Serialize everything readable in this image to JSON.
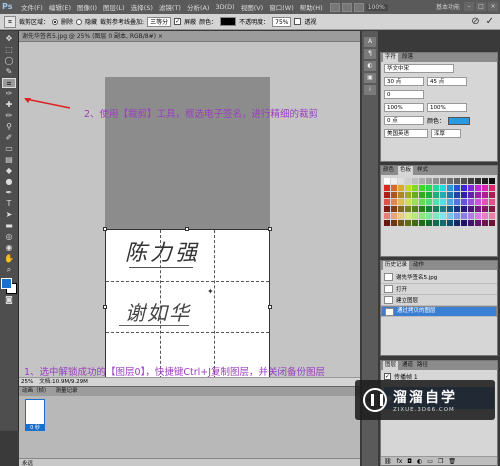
{
  "menubar": {
    "logo": "Ps",
    "items": [
      "文件(F)",
      "编辑(E)",
      "图像(I)",
      "图层(L)",
      "选择(S)",
      "滤镜(T)",
      "分析(A)",
      "3D(D)",
      "视图(V)",
      "窗口(W)",
      "帮助(H)"
    ],
    "zoom": "100%",
    "workspace": "基本功能",
    "win_min": "–",
    "win_max": "□",
    "win_close": "×"
  },
  "options": {
    "tool_icon": "crop-icon",
    "crop_area_label": "裁剪区域：",
    "delete_label": "删除",
    "hide_label": "隐藏",
    "guide_label": "裁剪参考线叠加:",
    "guide_value": "三等分",
    "shield_label": "屏蔽",
    "color_label": "颜色：",
    "opacity_label": "不透明度：",
    "opacity_value": "75%",
    "perspective_label": "透视",
    "cancel_glyph": "⊘",
    "commit_glyph": "✓"
  },
  "document": {
    "tab_title": "谢先华签名5.jpg @ 25% (图层 0 副本, RGB/8#) ×",
    "signature_top": "陈力强",
    "signature_bottom": "谢如华",
    "zoom_status": "25%",
    "doc_status": "文档:10.9M/9.29M"
  },
  "annotations": {
    "step2": "2、使用【裁剪】工具，框选电子签名，进行精细的裁剪",
    "step1": "1、选中解锁成功的【图层0】，快捷键Ctrl+J复制图层，并关闭备份图层"
  },
  "animation": {
    "tab1": "动画（帧）",
    "tab2": "测量记录",
    "frame_label": "0 秒",
    "footer": "永远"
  },
  "char_panel": {
    "tab1": "字符",
    "tab2": "段落",
    "font": "华文中宋",
    "size": "30 点",
    "leading": "45 点",
    "tracking": "0",
    "scale_v": "100%",
    "scale_h": "100%",
    "baseline": "0 点",
    "color_label": "颜色：",
    "language": "美国英语",
    "aa": "浑厚"
  },
  "swatch_panel": {
    "tab1": "颜色",
    "tab2": "色板",
    "tab3": "样式"
  },
  "history_panel": {
    "tab1": "历史记录",
    "tab2": "动作",
    "snapshot": "谢先华签名5.jpg",
    "items": [
      "打开",
      "建立图层",
      "通过拷贝的图层"
    ]
  },
  "layers_panel": {
    "tab1": "图层",
    "tab2": "通道",
    "tab3": "路径",
    "propagate": "传播帧 1"
  },
  "watermark": {
    "big": "溜溜自学",
    "small": "ZIXUE.3D66.COM"
  },
  "colors": {
    "annotation": "#9a3ec0",
    "accent": "#1e6fc8",
    "selection": "#3b7fd4"
  }
}
